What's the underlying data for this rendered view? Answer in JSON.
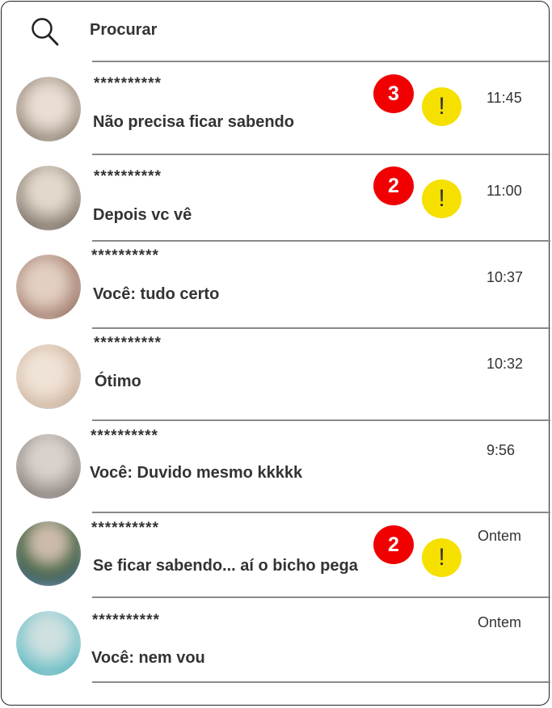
{
  "search": {
    "label": "Procurar",
    "icon": "search-icon"
  },
  "colors": {
    "badge": "#f00000",
    "warning": "#f6e000",
    "text": "#333333"
  },
  "conversations": [
    {
      "name": "**********",
      "message": "Não precisa ficar sabendo",
      "time": "11:45",
      "unread": "3",
      "warning": "!"
    },
    {
      "name": "**********",
      "message": "Depois vc vê",
      "time": "11:00",
      "unread": "2",
      "warning": "!"
    },
    {
      "name": "**********",
      "message": "Você: tudo certo",
      "time": "10:37"
    },
    {
      "name": "**********",
      "message": "Ótimo",
      "time": "10:32"
    },
    {
      "name": "**********",
      "message": "Você: Duvido mesmo kkkkk",
      "time": "9:56"
    },
    {
      "name": "**********",
      "message": "Se ficar sabendo... aí o bicho pega",
      "time": "Ontem",
      "unread": "2",
      "warning": "!"
    },
    {
      "name": "**********",
      "message": "Você: nem vou",
      "time": "Ontem"
    }
  ]
}
